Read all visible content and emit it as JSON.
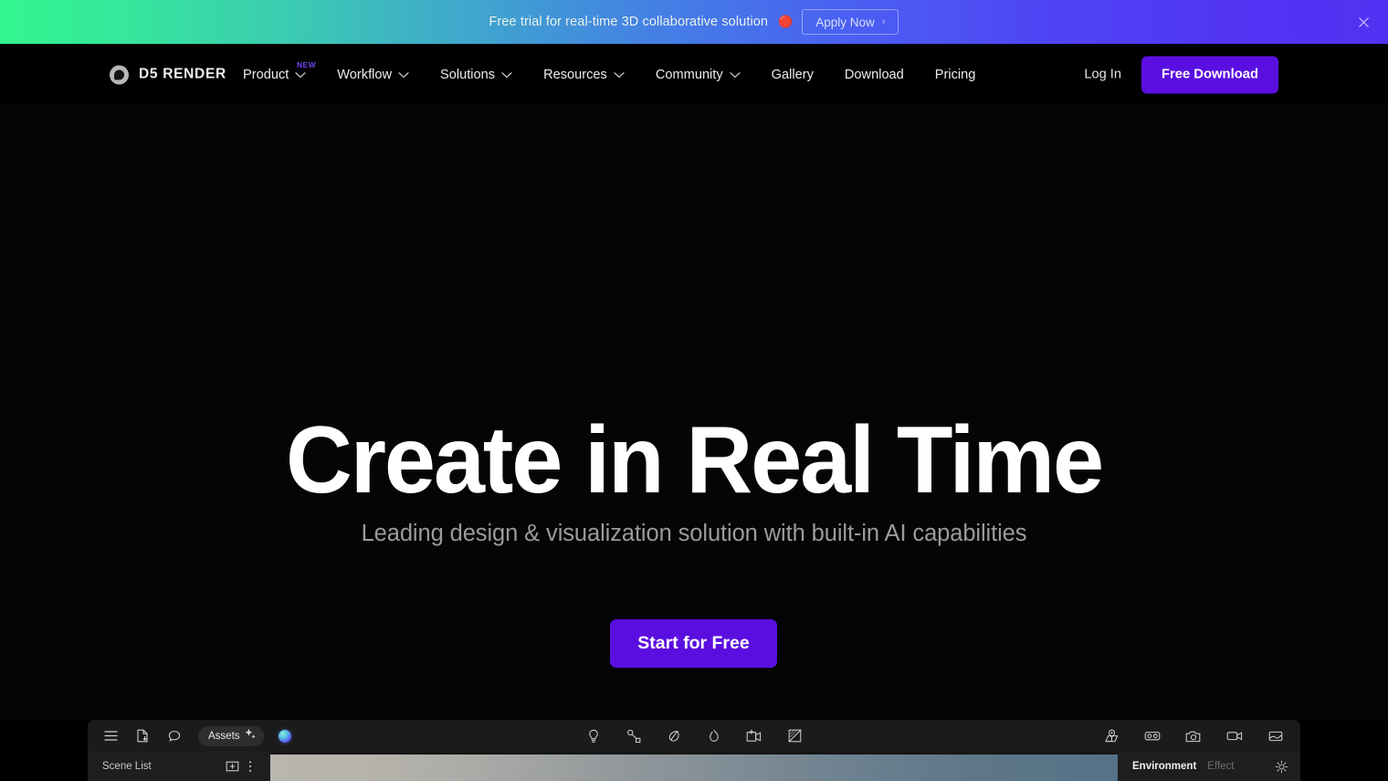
{
  "promo_banner": {
    "text": "Free trial for real-time 3D collaborative solution",
    "emoji": "🔴",
    "cta_label": "Apply Now",
    "cta_chevron": "›",
    "close_icon": "close-icon",
    "gradient_from": "#33F58E",
    "gradient_to": "#5331F2"
  },
  "navbar": {
    "brand": {
      "logo_icon": "d5-logo-icon",
      "name": "D5 RENDER"
    },
    "links": [
      {
        "label": "Product",
        "badge": "NEW",
        "has_dropdown": true
      },
      {
        "label": "Workflow",
        "badge": "",
        "has_dropdown": true
      },
      {
        "label": "Solutions",
        "badge": "",
        "has_dropdown": true
      },
      {
        "label": "Resources",
        "badge": "",
        "has_dropdown": true
      },
      {
        "label": "Community",
        "badge": "",
        "has_dropdown": true
      },
      {
        "label": "Gallery",
        "badge": "",
        "has_dropdown": false
      },
      {
        "label": "Download",
        "badge": "",
        "has_dropdown": false
      },
      {
        "label": "Pricing",
        "badge": "",
        "has_dropdown": false
      }
    ],
    "login_label": "Log In",
    "download_label": "Free Download",
    "accent_color": "#5A0FE0"
  },
  "hero": {
    "title": "Create in Real Time",
    "subtitle": "Leading design & visualization solution with built-in AI capabilities",
    "cta_label": "Start for Free",
    "cta_color": "#5A0FE0",
    "background_color": "#050505"
  },
  "app_window": {
    "toolbar_left": [
      {
        "icon": "hamburger-menu-icon"
      },
      {
        "icon": "file-import-icon"
      },
      {
        "icon": "comment-bubble-icon"
      }
    ],
    "assets_pill": {
      "label": "Assets",
      "icon": "ai-sparkle-icon"
    },
    "orb": {
      "icon": "gradient-orb-icon"
    },
    "toolbar_center": [
      {
        "icon": "light-bulb-icon"
      },
      {
        "icon": "path-node-icon"
      },
      {
        "icon": "leaf-icon"
      },
      {
        "icon": "water-drop-icon"
      },
      {
        "icon": "add-camera-icon"
      },
      {
        "icon": "split-view-icon"
      }
    ],
    "toolbar_right": [
      {
        "icon": "location-pin-icon"
      },
      {
        "icon": "vr-goggles-icon"
      },
      {
        "icon": "photo-camera-icon"
      },
      {
        "icon": "video-camera-icon"
      },
      {
        "icon": "panorama-icon"
      }
    ],
    "scene_panel": {
      "title": "Scene List",
      "add_icon": "add-scene-icon",
      "more_icon": "more-options-icon"
    },
    "right_panel": {
      "tab_active": "Environment",
      "tab_inactive": "Effect",
      "settings_icon": "gear-icon"
    }
  }
}
